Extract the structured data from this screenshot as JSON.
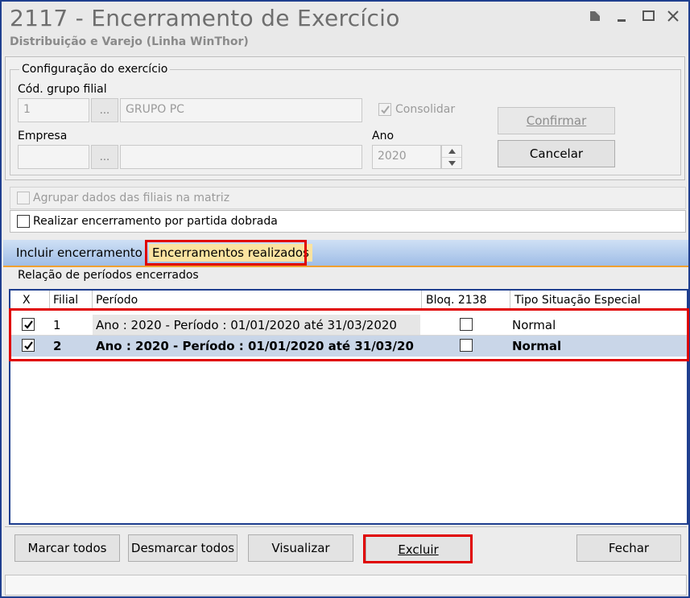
{
  "window": {
    "title": "2117 - Encerramento de Exercício",
    "subtitle": "Distribuição e Varejo (Linha WinThor)"
  },
  "config": {
    "legend": "Configuração do exercício",
    "cod_grupo_label": "Cód. grupo filial",
    "cod_grupo_value": "1",
    "ellipsis": "...",
    "grupo_desc": "GRUPO PC",
    "consolidar_label": "Consolidar",
    "empresa_label": "Empresa",
    "empresa_value": "",
    "empresa_desc": "",
    "ano_label": "Ano",
    "ano_value": "2020",
    "confirmar_label": "Confirmar",
    "cancelar_label": "Cancelar"
  },
  "options": {
    "agrupar_label": "Agrupar dados das filiais na matriz",
    "partida_label": "Realizar encerramento por partida dobrada"
  },
  "tabs": [
    {
      "label": "Incluir encerramento",
      "active": false
    },
    {
      "label": "Encerramentos realizados",
      "active": true
    }
  ],
  "relacao": {
    "legend": "Relação de períodos encerrados",
    "columns": [
      "X",
      "Filial",
      "Período",
      "Bloq. 2138",
      "Tipo Situação Especial"
    ],
    "rows": [
      {
        "checked": true,
        "filial": "1",
        "periodo": "Ano : 2020 - Período : 01/01/2020 até 31/03/2020",
        "bloq": false,
        "tipo": "Normal"
      },
      {
        "checked": true,
        "filial": "2",
        "periodo": "Ano : 2020 - Período : 01/01/2020 até 31/03/20",
        "bloq": false,
        "tipo": "Normal"
      }
    ]
  },
  "buttons": {
    "marcar": "Marcar todos",
    "desmarcar": "Desmarcar todos",
    "visualizar": "Visualizar",
    "excluir": "Excluir",
    "fechar": "Fechar"
  },
  "colors": {
    "accent_border": "#1f3f8f",
    "highlight_red": "#e00000",
    "tab_active_bg": "#fbe3a0",
    "selected_row_bg": "#c9d6e8"
  }
}
